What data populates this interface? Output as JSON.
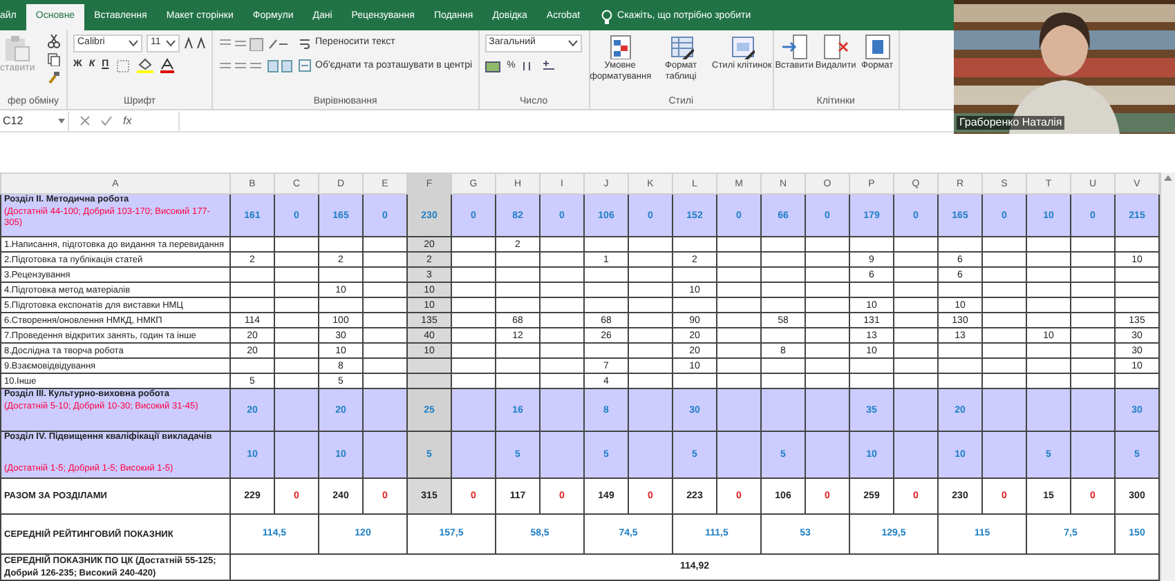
{
  "ribbon": {
    "tabs": [
      {
        "label": "айл",
        "selected": false
      },
      {
        "label": "Основне",
        "selected": true
      },
      {
        "label": "Вставлення",
        "selected": false
      },
      {
        "label": "Макет сторінки",
        "selected": false
      },
      {
        "label": "Формули",
        "selected": false
      },
      {
        "label": "Дані",
        "selected": false
      },
      {
        "label": "Рецензування",
        "selected": false
      },
      {
        "label": "Подання",
        "selected": false
      },
      {
        "label": "Довідка",
        "selected": false
      },
      {
        "label": "Acrobat",
        "selected": false
      }
    ],
    "tell_me": "Скажіть, що потрібно зробити",
    "clipboard": {
      "paste": "ставити",
      "label": "фер обміну"
    },
    "font": {
      "name": "Calibri",
      "size": "11",
      "bold": "Ж",
      "italic": "К",
      "underline": "П",
      "label": "Шрифт"
    },
    "alignment": {
      "wrap": "Переносити текст",
      "merge": "Об'єднати та розташувати в центрі",
      "label": "Вирівнювання"
    },
    "number": {
      "format": "Загальний",
      "percent": "%",
      "label": "Число"
    },
    "styles": {
      "buttons": [
        "Умовне форматування",
        "Формат таблиці",
        "Стилі клітинок"
      ],
      "label": "Стилі"
    },
    "cells": {
      "buttons": [
        "Вставити",
        "Видалити",
        "Формат"
      ],
      "label": "Клітинки"
    }
  },
  "formula_bar": {
    "name_box": "C12",
    "function_label": "fx"
  },
  "video": {
    "participant_name": "Граборенко Наталія"
  },
  "sheet": {
    "columns": [
      {
        "label": "A",
        "selected": false
      },
      {
        "label": "B",
        "selected": false
      },
      {
        "label": "C",
        "selected": false
      },
      {
        "label": "D",
        "selected": false
      },
      {
        "label": "E",
        "selected": false
      },
      {
        "label": "F",
        "selected": true
      },
      {
        "label": "G",
        "selected": false
      },
      {
        "label": "H",
        "selected": false
      },
      {
        "label": "I",
        "selected": false
      },
      {
        "label": "J",
        "selected": false
      },
      {
        "label": "K",
        "selected": false
      },
      {
        "label": "L",
        "selected": false
      },
      {
        "label": "M",
        "selected": false
      },
      {
        "label": "N",
        "selected": false
      },
      {
        "label": "O",
        "selected": false
      },
      {
        "label": "P",
        "selected": false
      },
      {
        "label": "Q",
        "selected": false
      },
      {
        "label": "R",
        "selected": false
      },
      {
        "label": "S",
        "selected": false
      },
      {
        "label": "T",
        "selected": false
      },
      {
        "label": "U",
        "selected": false
      },
      {
        "label": "V",
        "selected": false
      }
    ],
    "rows": [
      {
        "kind": "section",
        "title": "Розділ II. Методична робота",
        "range": "(Достатній 44-100; Добрий 103-170; Високий 177-305)",
        "cells": {
          "B": "161",
          "C": "0",
          "D": "165",
          "E": "0",
          "F": "230",
          "G": "0",
          "H": "82",
          "I": "0",
          "J": "106",
          "K": "0",
          "L": "152",
          "M": "0",
          "N": "66",
          "O": "0",
          "P": "179",
          "Q": "0",
          "R": "165",
          "S": "0",
          "T": "10",
          "U": "0",
          "V": "215"
        }
      },
      {
        "kind": "item",
        "label": "1.Написання, підготовка до видання та перевидання",
        "cells": {
          "F": "20",
          "H": "2"
        }
      },
      {
        "kind": "item",
        "label": "2.Підготовка та публікація статей",
        "cells": {
          "B": "2",
          "D": "2",
          "F": "2",
          "J": "1",
          "L": "2",
          "P": "9",
          "R": "6",
          "V": "10"
        }
      },
      {
        "kind": "item",
        "label": "3.Рецензування",
        "cells": {
          "F": "3",
          "P": "6",
          "R": "6"
        }
      },
      {
        "kind": "item",
        "label": "4.Підготовка метод матеріалів",
        "cells": {
          "D": "10",
          "F": "10",
          "L": "10"
        }
      },
      {
        "kind": "item",
        "label": "5.Підготовка експонатів для виставки НМЦ",
        "cells": {
          "F": "10",
          "P": "10",
          "R": "10"
        }
      },
      {
        "kind": "item",
        "label": "6.Створення/оновлення НМКД, НМКП",
        "cells": {
          "B": "114",
          "D": "100",
          "F": "135",
          "H": "68",
          "J": "68",
          "L": "90",
          "N": "58",
          "P": "131",
          "R": "130",
          "V": "135"
        }
      },
      {
        "kind": "item",
        "label": "7.Проведення відкритих занять, годин та інше",
        "cells": {
          "B": "20",
          "D": "30",
          "F": "40",
          "H": "12",
          "J": "26",
          "L": "20",
          "P": "13",
          "R": "13",
          "T": "10",
          "V": "30"
        }
      },
      {
        "kind": "item",
        "label": "8.Дослідна та творча робота",
        "cells": {
          "B": "20",
          "D": "10",
          "F": "10",
          "L": "20",
          "N": "8",
          "P": "10",
          "V": "30"
        }
      },
      {
        "kind": "item",
        "label": "9.Взаємовідвідування",
        "cells": {
          "D": "8",
          "J": "7",
          "L": "10",
          "V": "10"
        }
      },
      {
        "kind": "item",
        "label": "10.Інше",
        "cells": {
          "B": "5",
          "D": "5",
          "J": "4"
        }
      },
      {
        "kind": "section",
        "title": "Розділ III. Культурно-виховна робота",
        "range": "(Достатній 5-10; Добрий 10-30; Високий 31-45)",
        "cells": {
          "B": "20",
          "D": "20",
          "F": "25",
          "H": "16",
          "J": "8",
          "L": "30",
          "P": "35",
          "R": "20",
          "V": "30"
        }
      },
      {
        "kind": "section_tall",
        "title": "Розділ IV. Підвищення кваліфікації викладачів",
        "range": "(Достатній 1-5; Добрий 1-5; Високий 1-5)",
        "cells": {
          "B": "10",
          "D": "10",
          "F": "5",
          "H": "5",
          "J": "5",
          "L": "5",
          "N": "5",
          "P": "10",
          "R": "10",
          "T": "5",
          "V": "5"
        }
      },
      {
        "kind": "total",
        "label": "РАЗОМ ЗА РОЗДІЛАМИ",
        "cells": {
          "B": "229",
          "C": "0",
          "D": "240",
          "E": "0",
          "F": "315",
          "G": "0",
          "H": "117",
          "I": "0",
          "J": "149",
          "K": "0",
          "L": "223",
          "M": "0",
          "N": "106",
          "O": "0",
          "P": "259",
          "Q": "0",
          "R": "230",
          "S": "0",
          "T": "15",
          "U": "0",
          "V": "300"
        }
      },
      {
        "kind": "average",
        "label": "СЕРЕДНІЙ РЕЙТИНГОВИЙ ПОКАЗНИК",
        "values": [
          "114,5",
          "120",
          "157,5",
          "58,5",
          "74,5",
          "111,5",
          "53",
          "129,5",
          "115",
          "7,5",
          "150"
        ]
      },
      {
        "kind": "summary",
        "label": "СЕРЕДНІЙ ПОКАЗНИК ПО ЦК (Достатній 55-125; Добрий 126-235; Високий 240-420)",
        "values": [
          "114,92"
        ]
      }
    ]
  }
}
